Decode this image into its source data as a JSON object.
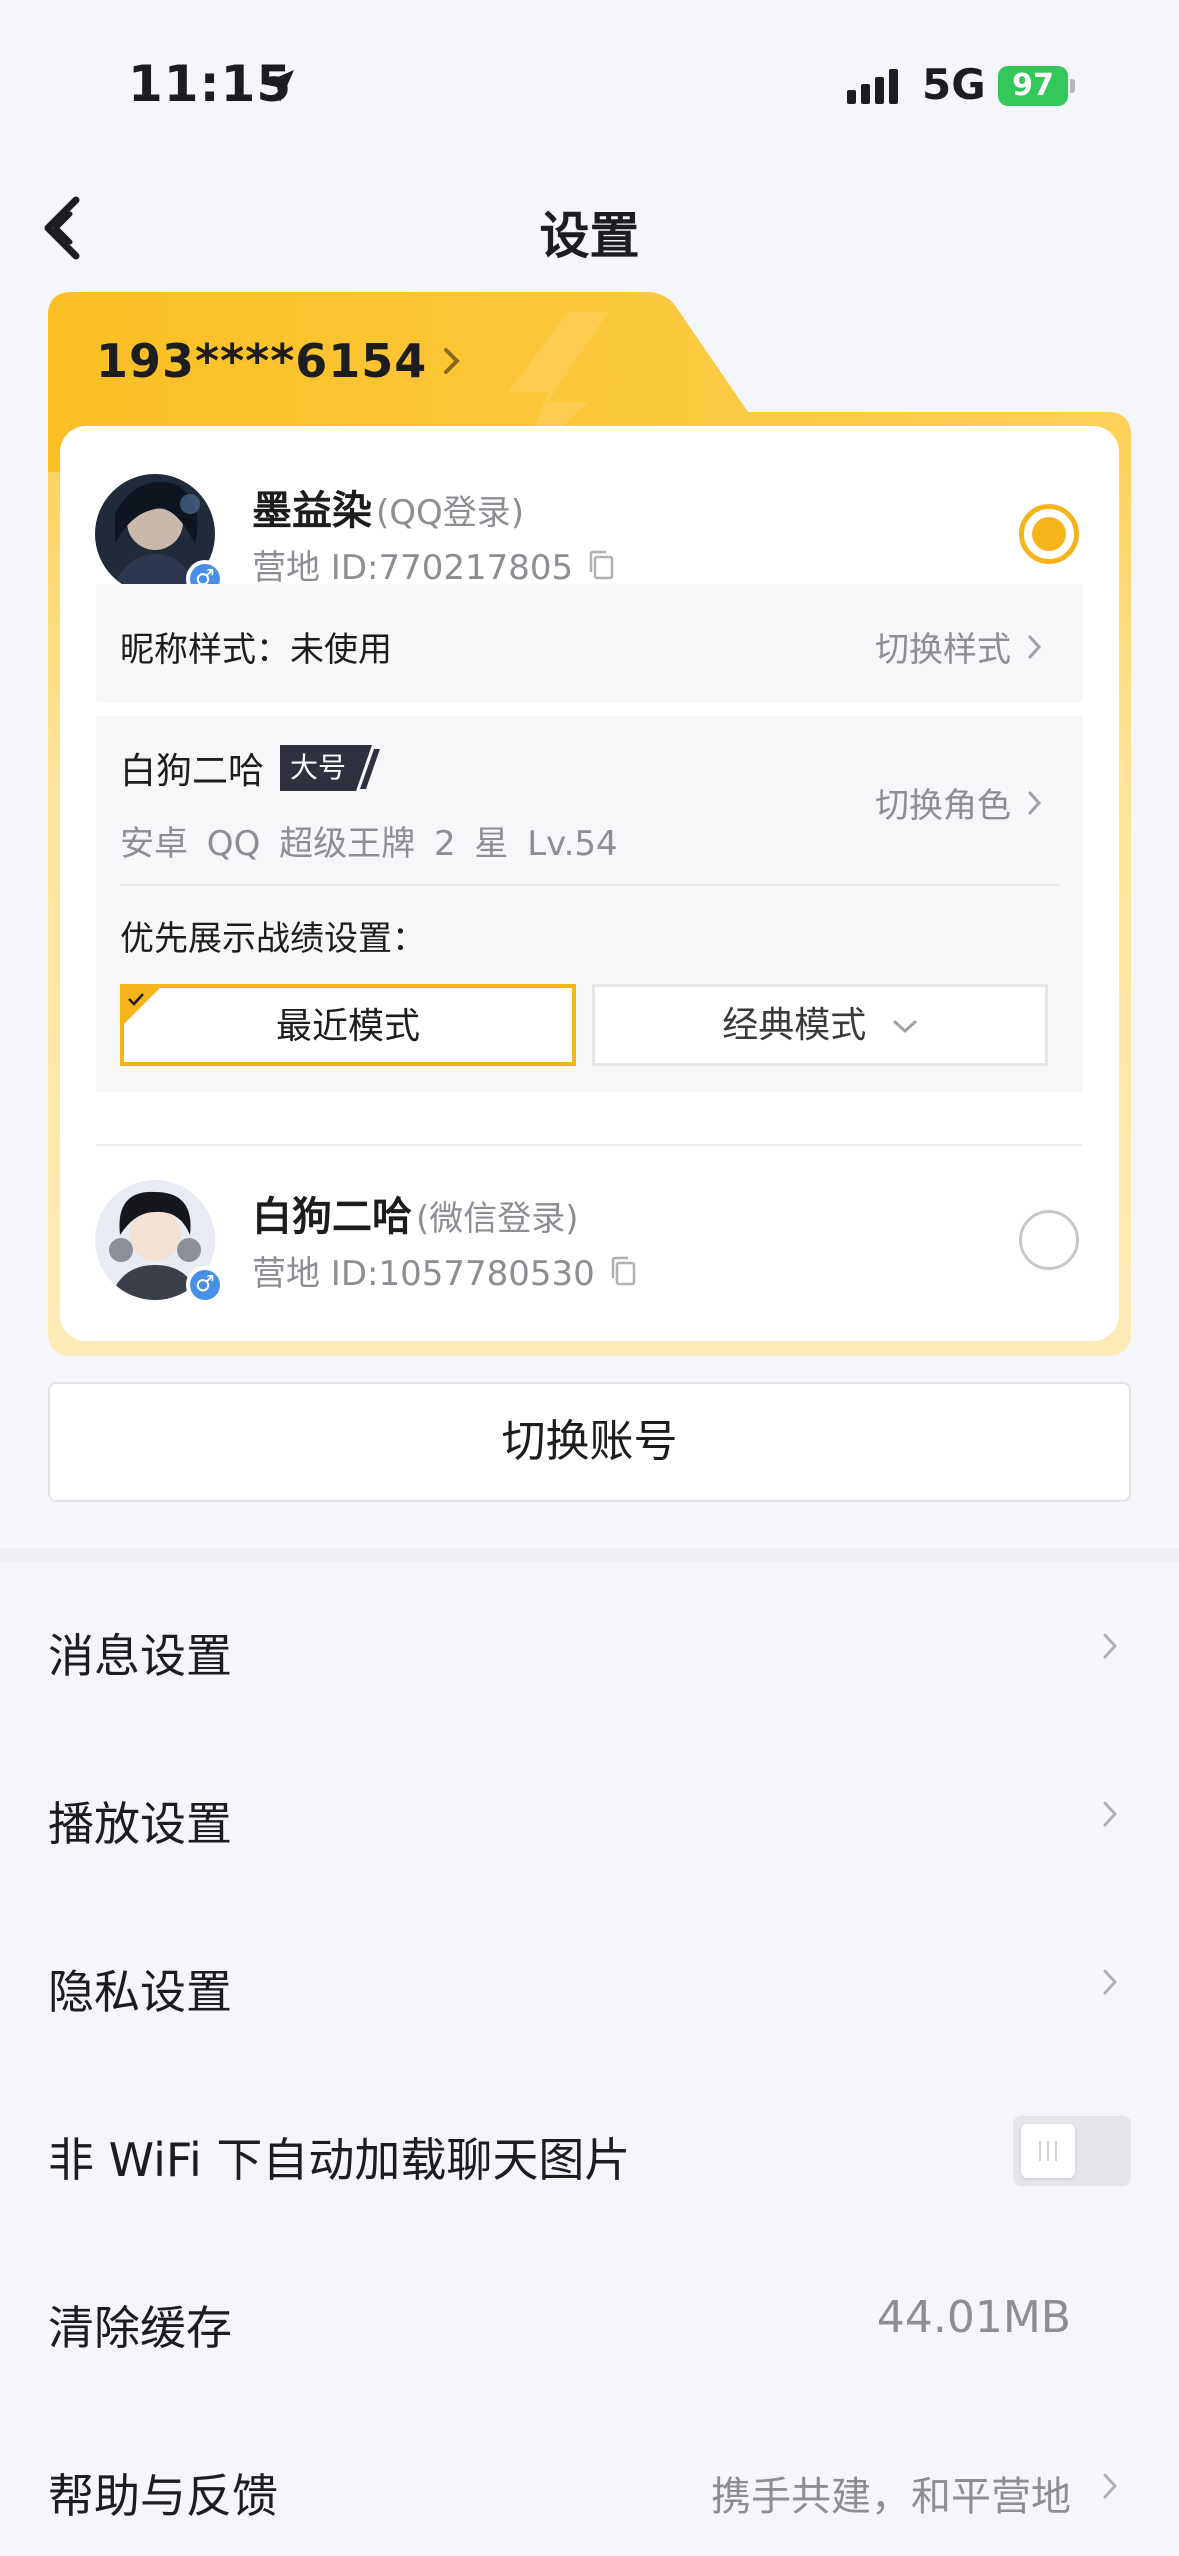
{
  "status_bar": {
    "time": "11:15",
    "network": "5G",
    "battery": "97"
  },
  "header": {
    "title": "设置"
  },
  "account_card": {
    "phone": "193****6154",
    "accounts": [
      {
        "name": "墨益染",
        "login_method": "(QQ登录)",
        "id_text": "营地 ID:770217805",
        "gender": "♂",
        "selected": true
      },
      {
        "name": "白狗二哈",
        "login_method": "(微信登录)",
        "id_text": "营地 ID:1057780530",
        "gender": "♂",
        "selected": false
      }
    ],
    "nickname_style": {
      "label": "昵称样式：未使用",
      "action": "切换样式"
    },
    "role": {
      "name": "白狗二哈",
      "tag": "大号",
      "detail": "安卓 QQ  超级王牌 2 星  Lv.54",
      "action": "切换角色",
      "priority_label": "优先展示战绩设置：",
      "mode_recent": "最近模式",
      "mode_classic": "经典模式"
    }
  },
  "switch_account_label": "切换账号",
  "settings": {
    "message": "消息设置",
    "playback": "播放设置",
    "privacy": "隐私设置",
    "auto_load_images": "非 WiFi 下自动加载聊天图片",
    "auto_load_images_on": false,
    "clear_cache": "清除缓存",
    "cache_size": "44.01MB",
    "help": "帮助与反馈",
    "help_hint": "携手共建，和平营地"
  },
  "colors": {
    "accent": "#f6b41b",
    "card_gold": "#fcc63a",
    "badge_blue": "#4a8fe6",
    "battery_green": "#34c759"
  }
}
